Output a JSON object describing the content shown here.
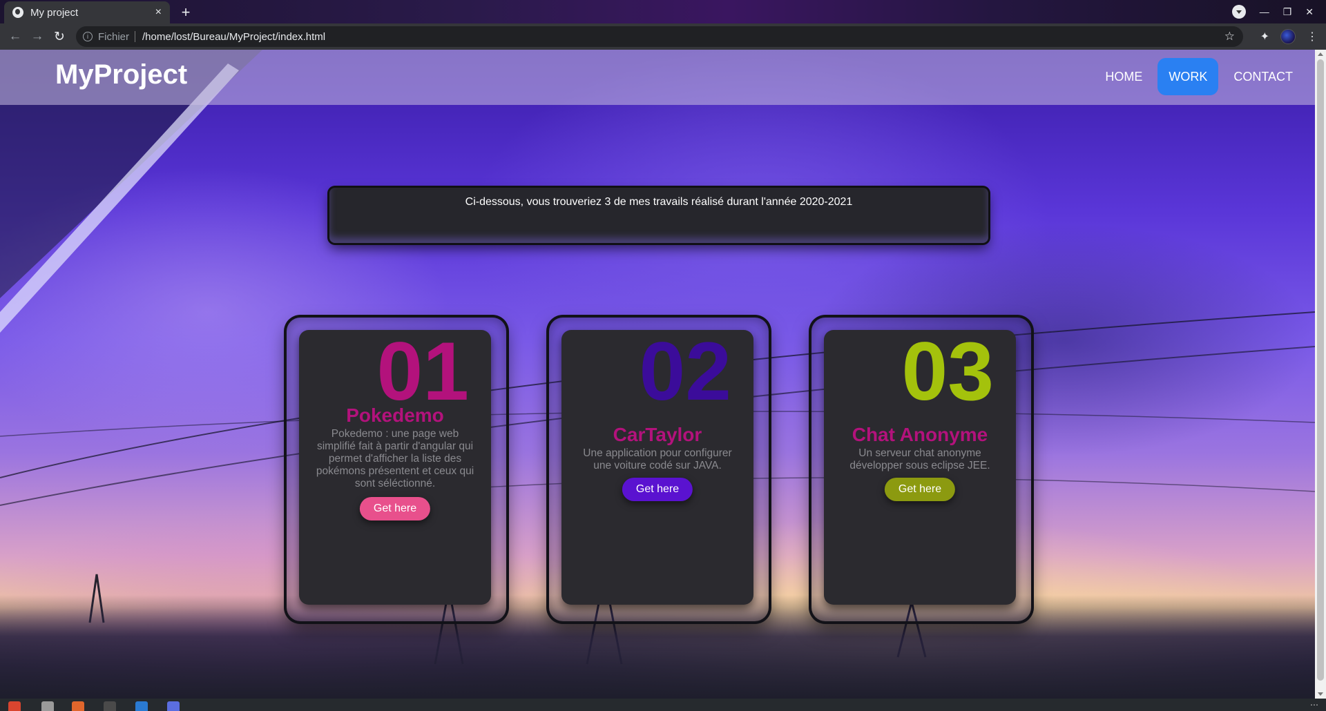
{
  "browser": {
    "tab_title": "My project",
    "tab_close": "×",
    "new_tab": "+",
    "url_scheme": "Fichier",
    "url": "/home/lost/Bureau/MyProject/index.html"
  },
  "site": {
    "logo": "MyProject",
    "nav": [
      "HOME",
      "WORK",
      "CONTACT"
    ],
    "active_nav": "WORK",
    "intro": "Ci-dessous, vous trouveriez 3 de mes travails réalisé durant l'année 2020-2021"
  },
  "cards": [
    {
      "number": "01",
      "title": "Pokedemo",
      "description": "Pokedemo : une page web simplifié fait à partir d'angular qui permet d'afficher la liste des pokémons présentent et ceux qui sont séléctionné.",
      "button": "Get here",
      "number_color": "#b3127c",
      "button_color": "#e8508c"
    },
    {
      "number": "02",
      "title": "CarTaylor",
      "description": "Une application pour configurer une voiture codé sur JAVA.",
      "button": "Get here",
      "number_color": "#3b0c9a",
      "button_color": "#5a12d0"
    },
    {
      "number": "03",
      "title": "Chat Anonyme",
      "description": "Un serveur chat anonyme développer sous eclipse JEE.",
      "button": "Get here",
      "number_color": "#a4c20c",
      "button_color": "#8c9a10"
    }
  ],
  "colors": {
    "accent": "#2a80f2",
    "card_title": "#b3127c",
    "card_bg": "#2b2a2f"
  }
}
